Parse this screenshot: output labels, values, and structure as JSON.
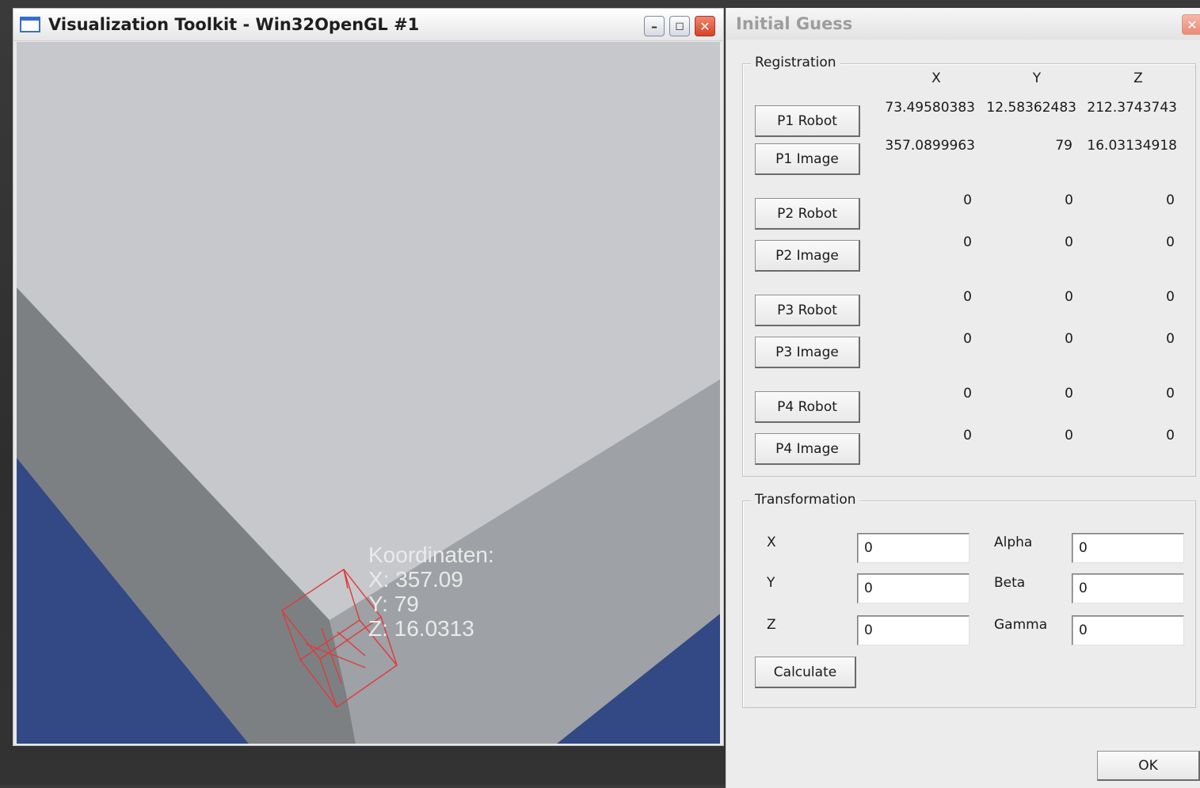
{
  "vtk": {
    "title": "Visualization Toolkit - Win32OpenGL #1",
    "overlay": {
      "heading": "Koordinaten:",
      "x": "X: 357.09",
      "y": "Y: 79",
      "z": "Z: 16.0313"
    },
    "colors": {
      "background": "#c7c8cb",
      "left_band": "#7d8083",
      "right_band": "#9ea1a5",
      "blue": "#324985",
      "cube": "#e03a3a"
    }
  },
  "dialog": {
    "title": "Initial Guess",
    "registration": {
      "legend": "Registration",
      "headers": [
        "X",
        "Y",
        "Z"
      ],
      "rows": [
        {
          "label": "P1 Robot",
          "values": [
            "73.49580383",
            "12.58362483",
            "212.3743743"
          ]
        },
        {
          "label": "P1 Image",
          "values": [
            "357.0899963",
            "79",
            "16.03134918"
          ]
        },
        {
          "label": "P2 Robot",
          "values": [
            "0",
            "0",
            "0"
          ]
        },
        {
          "label": "P2 Image",
          "values": [
            "0",
            "0",
            "0"
          ]
        },
        {
          "label": "P3 Robot",
          "values": [
            "0",
            "0",
            "0"
          ]
        },
        {
          "label": "P3 Image",
          "values": [
            "0",
            "0",
            "0"
          ]
        },
        {
          "label": "P4 Robot",
          "values": [
            "0",
            "0",
            "0"
          ]
        },
        {
          "label": "P4 Image",
          "values": [
            "0",
            "0",
            "0"
          ]
        }
      ]
    },
    "transformation": {
      "legend": "Transformation",
      "x_label": "X",
      "x_value": "0",
      "y_label": "Y",
      "y_value": "0",
      "z_label": "Z",
      "z_value": "0",
      "alpha_label": "Alpha",
      "alpha_value": "0",
      "beta_label": "Beta",
      "beta_value": "0",
      "gamma_label": "Gamma",
      "gamma_value": "0",
      "calculate_label": "Calculate"
    },
    "ok_label": "OK"
  }
}
